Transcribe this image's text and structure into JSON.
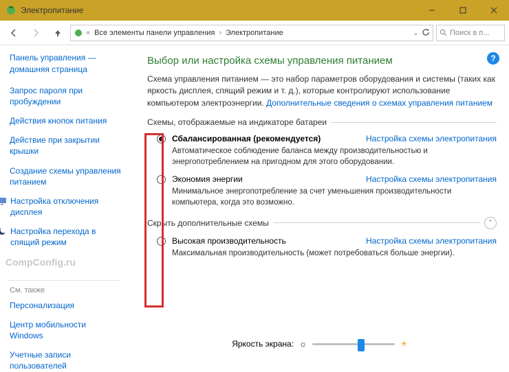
{
  "window": {
    "title": "Электропитание"
  },
  "nav": {
    "crumbs": [
      "Все элементы панели управления",
      "Электропитание"
    ],
    "search_placeholder": "Поиск в п..."
  },
  "sidebar": {
    "home": "Панель управления — домашняя страница",
    "links": [
      "Запрос пароля при пробуждении",
      "Действия кнопок питания",
      "Действие при закрытии крышки",
      "Создание схемы управления питанием"
    ],
    "icon_links": [
      "Настройка отключения дисплея",
      "Настройка перехода в спящий режим"
    ],
    "watermark": "CompConfig.ru",
    "seealso_head": "См. также",
    "seealso": [
      "Персонализация",
      "Центр мобильности Windows",
      "Учетные записи пользователей"
    ]
  },
  "main": {
    "heading": "Выбор или настройка схемы управления питанием",
    "description": "Схема управления питанием — это набор параметров оборудования и системы (таких как яркость дисплея, спящий режим и т. д.), которые контролируют использование компьютером электроэнергии. ",
    "desc_link": "Дополнительные сведения о схемах управления питанием",
    "group1_legend": "Схемы, отображаемые на индикаторе батареи",
    "group2_legend": "Скрыть дополнительные схемы",
    "plans": [
      {
        "title": "Сбалансированная (рекомендуется)",
        "checked": true,
        "bold": true,
        "link": "Настройка схемы электропитания",
        "desc": "Автоматическое соблюдение баланса между производительностью и энергопотреблением на пригодном для этого оборудовании."
      },
      {
        "title": "Экономия энергии",
        "checked": false,
        "bold": false,
        "link": "Настройка схемы электропитания",
        "desc": "Минимальное энергопотребление за счет уменьшения производительности компьютера, когда это возможно."
      }
    ],
    "hidden_plans": [
      {
        "title": "Высокая производительность",
        "checked": false,
        "bold": false,
        "link": "Настройка схемы электропитания",
        "desc": "Максимальная производительность (может потребоваться больше энергии)."
      }
    ],
    "brightness_label": "Яркость экрана:",
    "brightness_value": 55
  }
}
